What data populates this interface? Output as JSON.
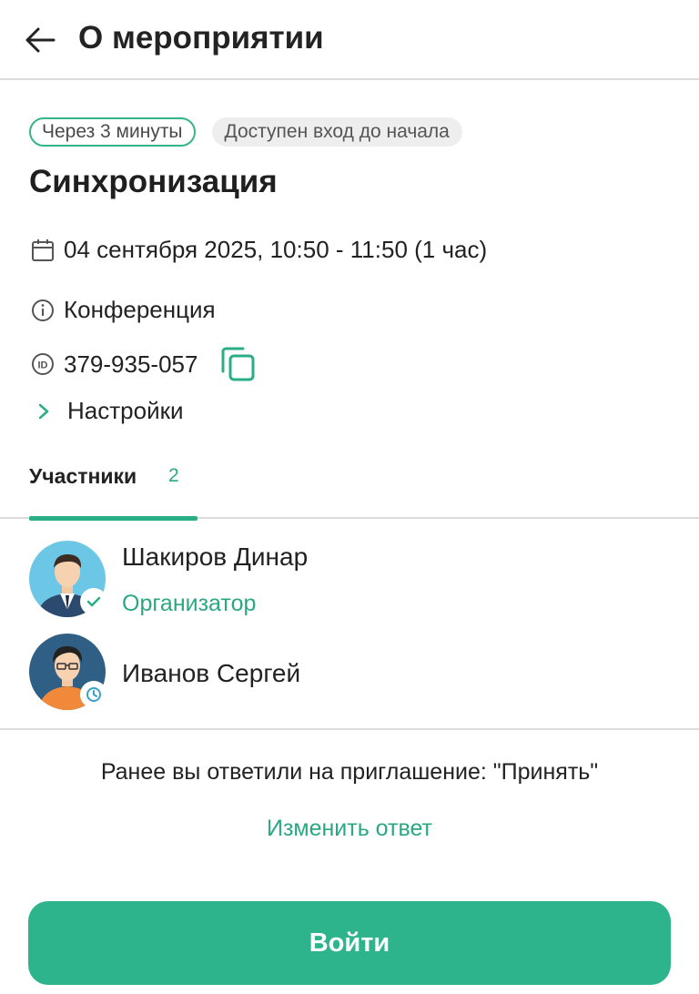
{
  "header": {
    "title": "О мероприятии",
    "back_icon": "arrow-left-icon"
  },
  "event": {
    "badge_time": "Через 3 минуты",
    "badge_access": "Доступен вход до начала",
    "title": "Синхронизация",
    "datetime": "04 сентября 2025, 10:50 - 11:50 (1 час)",
    "type": "Конференция",
    "id": "379-935-057",
    "settings_label": "Настройки"
  },
  "tabs": {
    "participants_label": "Участники",
    "participants_count": "2"
  },
  "participants": [
    {
      "name": "Шакиров Динар",
      "role": "Организатор",
      "status_icon": "check-icon"
    },
    {
      "name": "Иванов Сергей",
      "role": "",
      "status_icon": "clock-icon"
    }
  ],
  "response": {
    "text": "Ранее вы ответили на приглашение: \"Принять\"",
    "change_label": "Изменить ответ"
  },
  "join_button": {
    "label": "Войти"
  },
  "colors": {
    "accent": "#2db48d",
    "accent_text": "#2aa883",
    "divider": "#dcdcdc"
  }
}
